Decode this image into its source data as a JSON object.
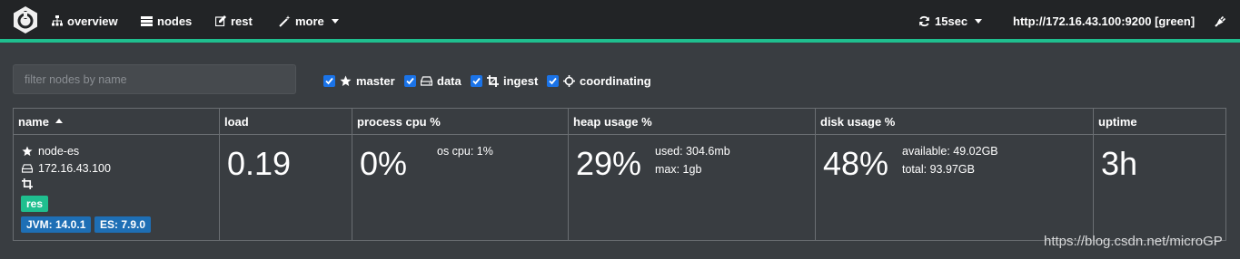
{
  "nav": {
    "items": [
      {
        "label": "overview",
        "icon": "sitemap-icon"
      },
      {
        "label": "nodes",
        "icon": "server-icon"
      },
      {
        "label": "rest",
        "icon": "edit-icon"
      },
      {
        "label": "more",
        "icon": "magic-wand-icon"
      }
    ],
    "refresh_interval": "15sec",
    "cluster_url": "http://172.16.43.100:9200 [green]",
    "accent_color": "#1fbf8f"
  },
  "filter": {
    "placeholder": "filter nodes by name",
    "roles": [
      {
        "label": "master",
        "checked": true,
        "icon": "star-icon"
      },
      {
        "label": "data",
        "checked": true,
        "icon": "hdd-icon"
      },
      {
        "label": "ingest",
        "checked": true,
        "icon": "crop-icon"
      },
      {
        "label": "coordinating",
        "checked": true,
        "icon": "crosshairs-icon"
      }
    ]
  },
  "table": {
    "headers": {
      "name": "name",
      "load": "load",
      "cpu": "process cpu %",
      "heap": "heap usage %",
      "disk": "disk usage %",
      "uptime": "uptime"
    },
    "row": {
      "name": "node-es",
      "ip": "172.16.43.100",
      "badge": "res",
      "jvm": "JVM: 14.0.1",
      "es": "ES: 7.9.0",
      "load": "0.19",
      "cpu": "0%",
      "os_cpu": "os cpu: 1%",
      "heap": "29%",
      "heap_used": "used: 304.6mb",
      "heap_max": "max: 1gb",
      "disk": "48%",
      "disk_available": "available: 49.02GB",
      "disk_total": "total: 93.97GB",
      "uptime": "3h"
    }
  },
  "watermark": "https://blog.csdn.net/microGP"
}
